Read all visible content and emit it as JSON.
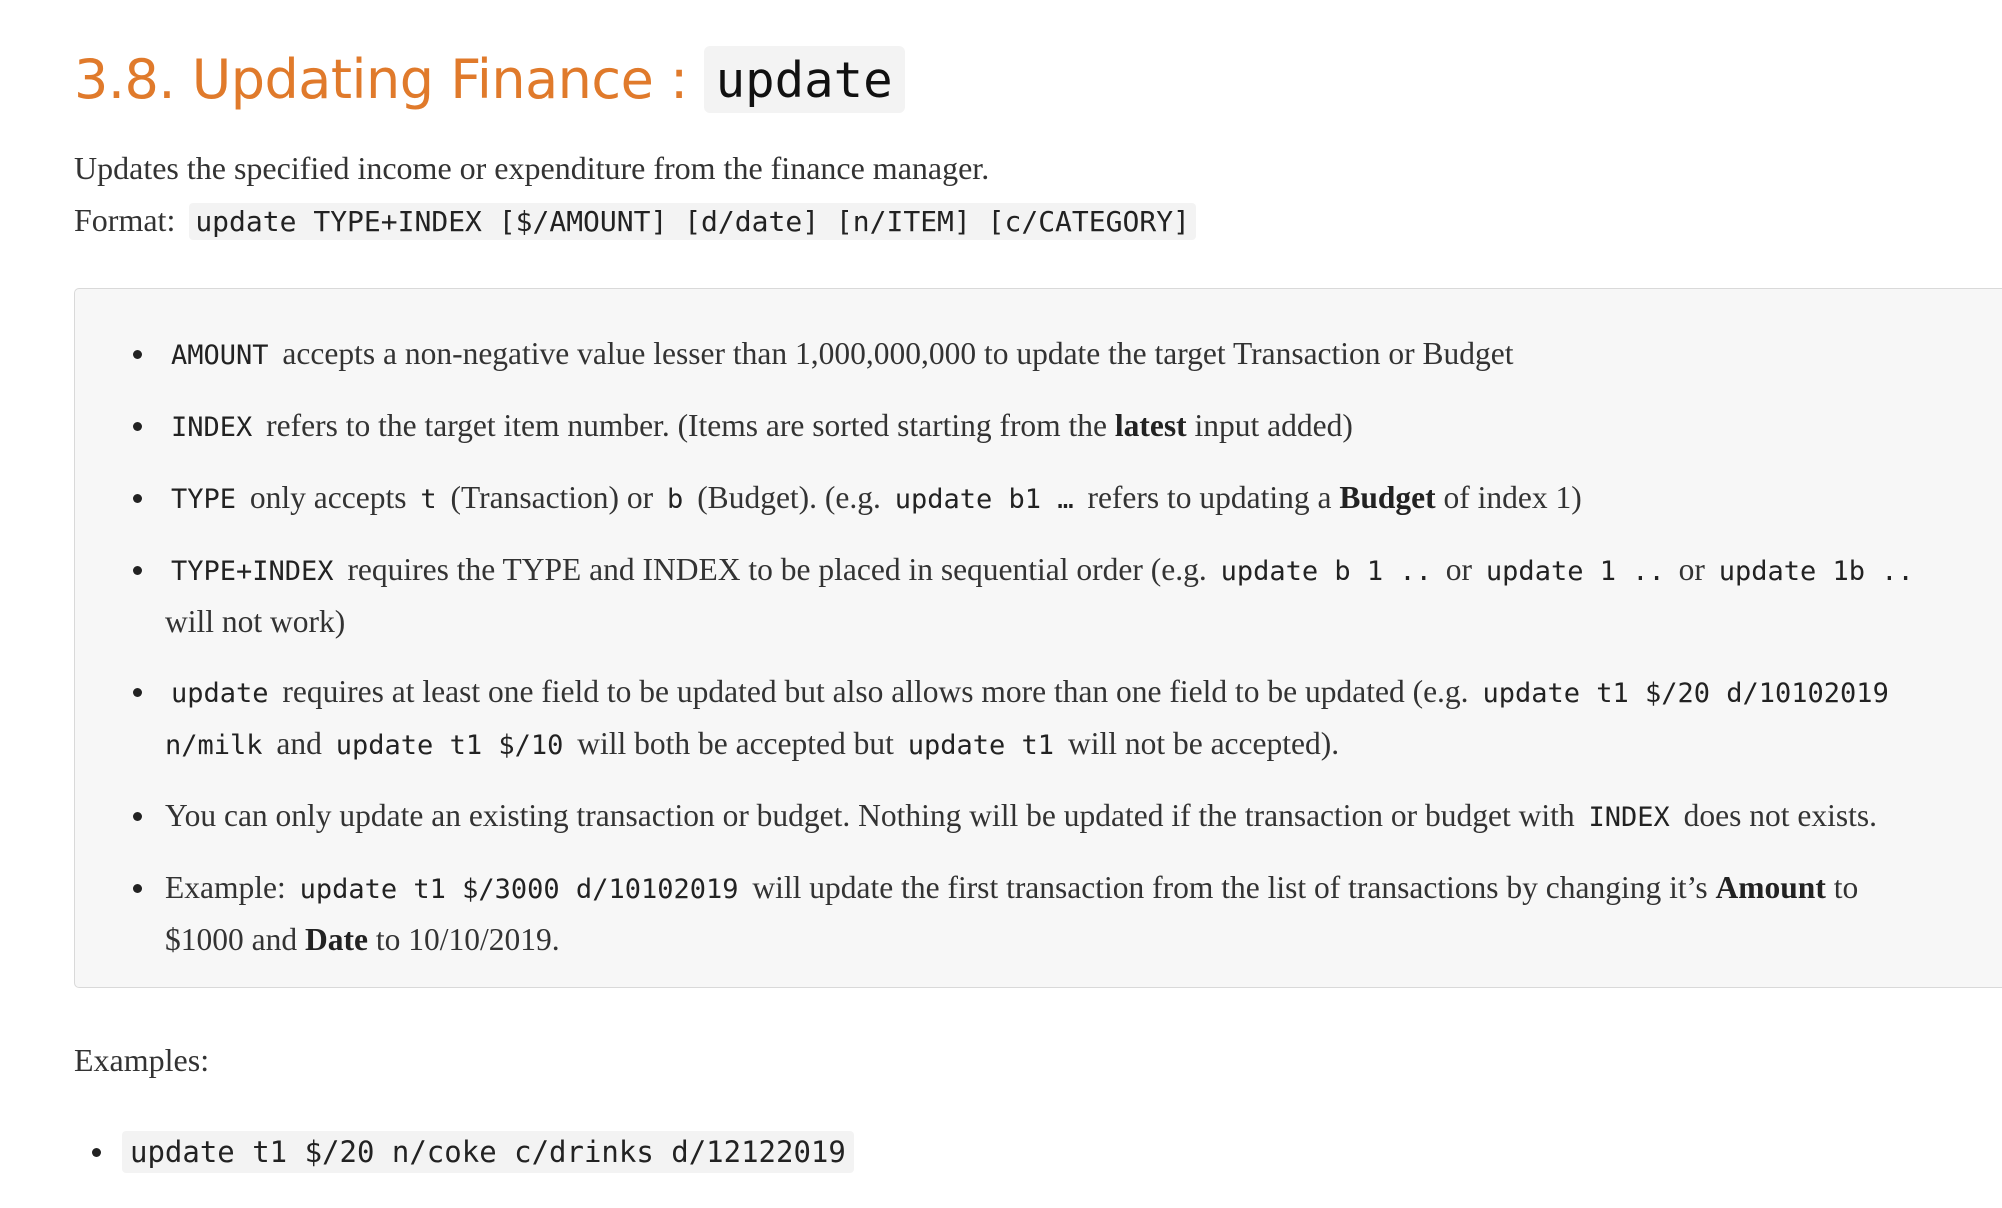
{
  "heading": {
    "title": "3.8. Updating Finance :",
    "command": "update"
  },
  "intro": {
    "description": "Updates the specified income or expenditure from the finance manager.",
    "format_label": "Format:",
    "format_code": "update TYPE+INDEX [$/AMOUNT] [d/date] [n/ITEM] [c/CATEGORY]"
  },
  "notes": {
    "amount": {
      "code": "AMOUNT",
      "text": "accepts a non-negative value lesser than 1,000,000,000 to update the target Transaction or Budget"
    },
    "index": {
      "code": "INDEX",
      "text1": "refers to the target item number. (Items are sorted starting from the",
      "bold": "latest",
      "text2": "input added)"
    },
    "type": {
      "code": "TYPE",
      "text1": "only accepts",
      "code_t": "t",
      "text2": "(Transaction) or",
      "code_b": "b",
      "text3": "(Budget). (e.g.",
      "code_example": "update b1 …",
      "text4": "refers to updating a",
      "bold": "Budget",
      "text5": "of index 1)"
    },
    "type_index": {
      "code": "TYPE+INDEX",
      "text1": "requires the TYPE and INDEX to be placed in sequential order (e.g.",
      "code1": "update b 1 ..",
      "or1": "or",
      "code2": "update 1 ..",
      "or2": "or",
      "code3": "update 1b ..",
      "text2": "will not work)"
    },
    "update_fields": {
      "code": "update",
      "text1": "requires at least one field to be updated but also allows more than one field to be updated (e.g.",
      "code1": "update t1 $/20 d/10102019 n/milk",
      "and": "and",
      "code2": "update t1 $/10",
      "text2": "will both be accepted but",
      "code3": "update t1",
      "text3": "will not be accepted)."
    },
    "existing": {
      "text1": "You can only update an existing transaction or budget. Nothing will be updated if the transaction or budget with",
      "code": "INDEX",
      "text2": "does not exists."
    },
    "example": {
      "label": "Example:",
      "code": "update t1 $/3000 d/10102019",
      "text1": "will update the first transaction from the list of transactions by changing it’s",
      "bold1": "Amount",
      "text2": "to $1000 and",
      "bold2": "Date",
      "text3": "to 10/10/2019."
    }
  },
  "examples": {
    "label": "Examples:",
    "items": [
      "update t1 $/20 n/coke c/drinks d/12122019"
    ]
  }
}
